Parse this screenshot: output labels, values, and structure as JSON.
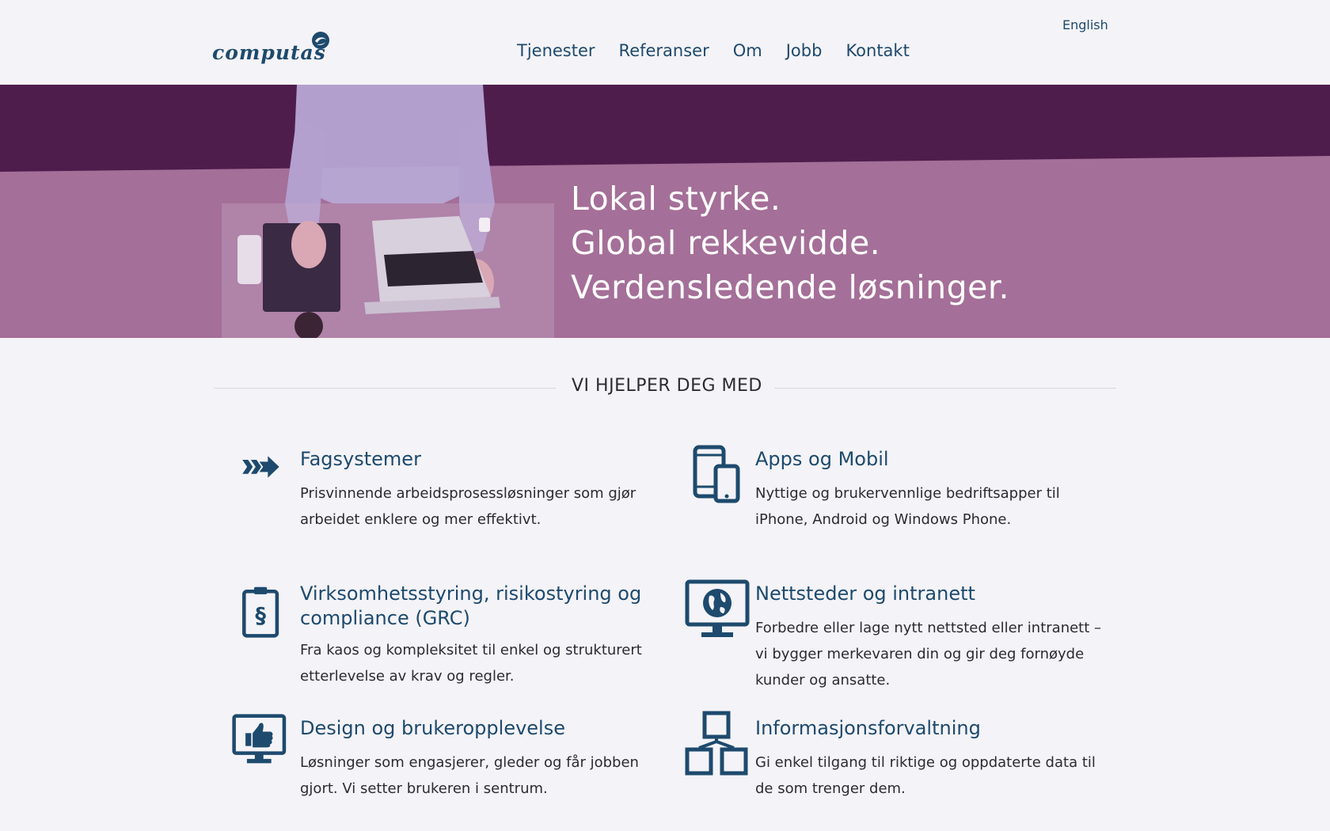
{
  "header": {
    "logo_text": "computas",
    "nav": [
      "Tjenester",
      "Referanser",
      "Om",
      "Jobb",
      "Kontakt"
    ],
    "language_link": "English"
  },
  "hero": {
    "lines": [
      "Lokal styrke.",
      "Global rekkevidde.",
      "Verdensledende løsninger."
    ]
  },
  "section": {
    "title": "VI HJELPER DEG MED"
  },
  "services": [
    {
      "icon": "arrows-icon",
      "title_lines": [
        "Fagsystemer"
      ],
      "desc_lines": [
        "Prisvinnende arbeidsprosessløsninger som gjør",
        "arbeidet enklere og mer effektivt."
      ]
    },
    {
      "icon": "mobile-devices-icon",
      "title_lines": [
        "Apps og Mobil"
      ],
      "desc_lines": [
        "Nyttige og brukervennlige bedriftsapper til",
        "iPhone, Android og Windows Phone."
      ]
    },
    {
      "icon": "clipboard-paragraph-icon",
      "title_lines": [
        "Virksomhetsstyring, risikostyring og",
        "compliance (GRC)"
      ],
      "desc_lines": [
        "Fra kaos og kompleksitet til enkel og strukturert",
        "etterlevelse av krav og regler."
      ]
    },
    {
      "icon": "globe-monitor-icon",
      "title_lines": [
        "Nettsteder og intranett"
      ],
      "desc_lines": [
        "Forbedre eller lage nytt nettsted eller intranett –",
        "vi bygger merkevaren din og gir deg fornøyde",
        "kunder og ansatte."
      ]
    },
    {
      "icon": "thumbs-up-monitor-icon",
      "title_lines": [
        "Design og brukeropplevelse"
      ],
      "desc_lines": [
        "Løsninger som engasjerer, gleder og får jobben",
        "gjort. Vi setter brukeren i sentrum."
      ]
    },
    {
      "icon": "hierarchy-icon",
      "title_lines": [
        "Informasjonsforvaltning"
      ],
      "desc_lines": [
        "Gi enkel tilgang til riktige og oppdaterte data til",
        "de som trenger dem."
      ]
    }
  ],
  "colors": {
    "brand_blue": "#1d4a6d",
    "hero_dark": "#4f1d4c",
    "hero_light": "#a46f98",
    "background": "#f4f3f7"
  }
}
